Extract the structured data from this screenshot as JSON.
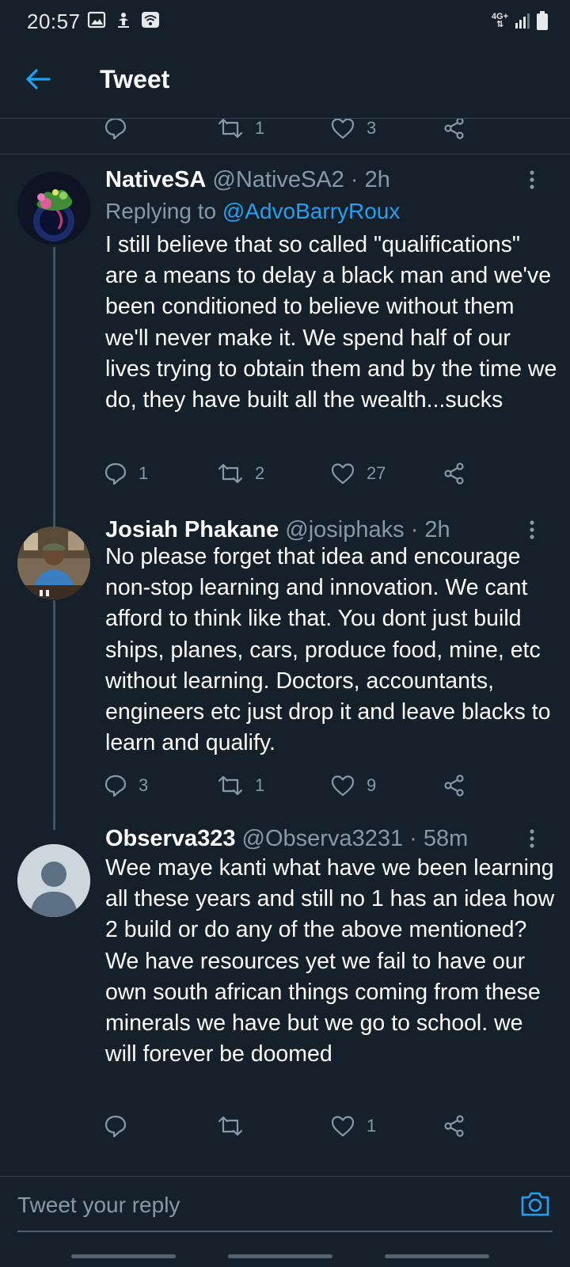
{
  "status_bar": {
    "time": "20:57",
    "network": "4G+",
    "icons": [
      "image-icon",
      "download-icon",
      "wifi-icon",
      "signal-icon",
      "battery-icon"
    ]
  },
  "header": {
    "title": "Tweet"
  },
  "colors": {
    "background": "#15202b",
    "accent": "#1da1f2",
    "muted": "#8899a6",
    "divider": "#38444d"
  },
  "previous_tweet": {
    "replies": "",
    "retweets": "1",
    "likes": "3"
  },
  "tweets": [
    {
      "name": "NativeSA",
      "handle": "@NativeSA2",
      "time": "· 2h",
      "replying_label": "Replying to",
      "replying_to": "@AdvoBarryRoux",
      "text": "I still believe that so called \"qualifications\" are a means to delay a black man and we've been conditioned to believe without them we'll never make it. We spend half of our lives trying to obtain them and by the time we do, they have built all the wealth...sucks",
      "replies": "1",
      "retweets": "2",
      "likes": "27"
    },
    {
      "name": "Josiah Phakane",
      "handle": "@josiphaks",
      "time": "· 2h",
      "text": "No please forget that idea and encourage non-stop learning and innovation. We cant afford to think like that. You dont just build ships, planes, cars, produce food, mine, etc without learning. Doctors, accountants, engineers etc just drop it and leave blacks to learn and qualify.",
      "replies": "3",
      "retweets": "1",
      "likes": "9"
    },
    {
      "name": "Observa323",
      "handle": "@Observa3231",
      "time": "· 58m",
      "text": "Wee maye kanti what have we been learning all these years and still no 1 has an idea how 2 build or do any of the above mentioned? We have resources yet we fail to have our own south african things coming from these minerals we have but we go to school. we will forever be doomed",
      "replies": "",
      "retweets": "",
      "likes": "1"
    }
  ],
  "reply_bar": {
    "placeholder": "Tweet your reply"
  }
}
